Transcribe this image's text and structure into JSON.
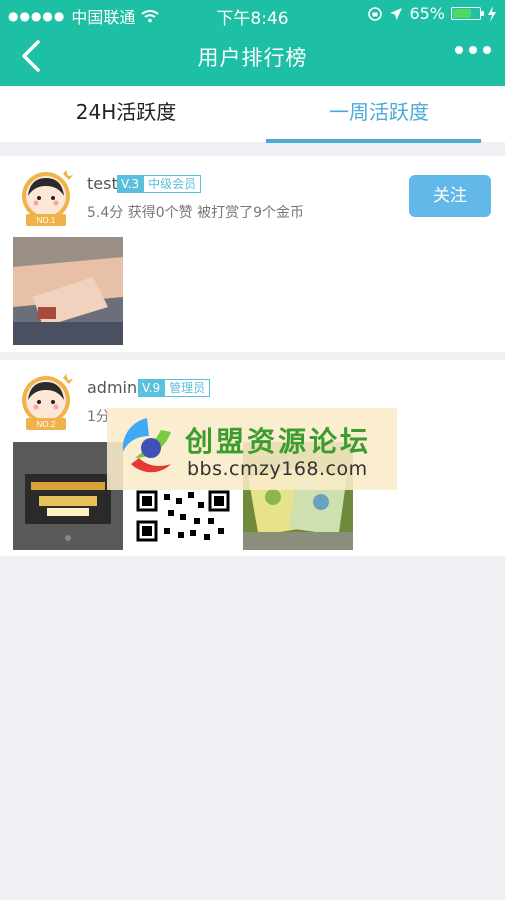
{
  "status_bar": {
    "carrier": "中国联通",
    "time": "下午8:46",
    "battery": "65%"
  },
  "nav": {
    "title": "用户排行榜"
  },
  "tabs": [
    {
      "label": "24H活跃度",
      "active": false
    },
    {
      "label": "一周活跃度",
      "active": true
    }
  ],
  "users": [
    {
      "rank_badge": "NO.1",
      "name": "test",
      "level": "V.3",
      "role": "中级会员",
      "stats": "5.4分 获得0个赞 被打赏了9个金币",
      "follow_label": "关注"
    },
    {
      "rank_badge": "NO.2",
      "name": "admin",
      "level": "V.9",
      "role": "管理员",
      "stats_partial": "1分"
    }
  ],
  "watermark": {
    "title": "创盟资源论坛",
    "url": "bbs.cmzy168.com"
  },
  "colors": {
    "header": "#1dbfa5",
    "accent": "#4aaad8",
    "follow": "#63b8ea"
  }
}
